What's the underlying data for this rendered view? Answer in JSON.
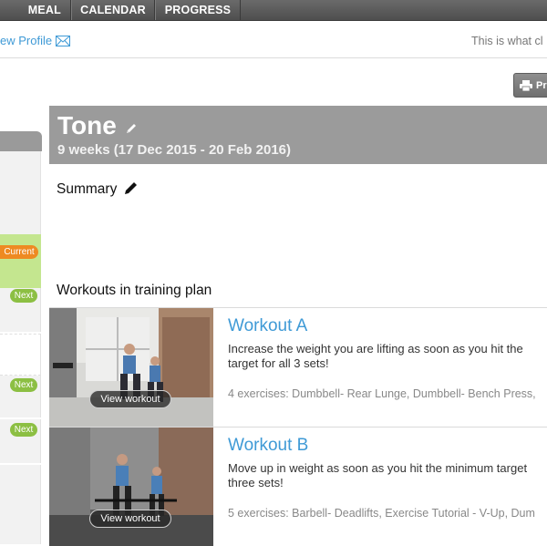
{
  "nav": {
    "tabs": [
      {
        "label": "MEAL PLAN"
      },
      {
        "label": "CALENDAR"
      },
      {
        "label": "PROGRESS"
      }
    ]
  },
  "profile_bar": {
    "view_profile": "ew Profile",
    "right_text": "This is what cl"
  },
  "toolbar": {
    "print_label": "Pr"
  },
  "sidebar": {
    "current_badge": "Current",
    "next_badge": "Next"
  },
  "plan": {
    "title": "Tone",
    "subtitle": "9 weeks (17 Dec 2015 - 20 Feb 2016)",
    "summary_label": "Summary",
    "workouts_label": "Workouts in training plan"
  },
  "workouts": [
    {
      "title": "Workout A",
      "description": "Increase the weight you are lifting as soon as you hit the target for all 3 sets!",
      "exercises": "4 exercises: Dumbbell- Rear Lunge, Dumbbell- Bench Press,",
      "view_label": "View workout"
    },
    {
      "title": "Workout B",
      "description": "Move up in weight as soon as you hit the minimum target three sets!",
      "exercises": "5 exercises: Barbell- Deadlifts, Exercise Tutorial - V-Up, Dum",
      "view_label": "View workout"
    }
  ],
  "colors": {
    "accent_blue": "#3f9ad6",
    "current_orange": "#ee8a22",
    "next_green": "#8cbf43",
    "header_gray": "#9b9b9b"
  }
}
